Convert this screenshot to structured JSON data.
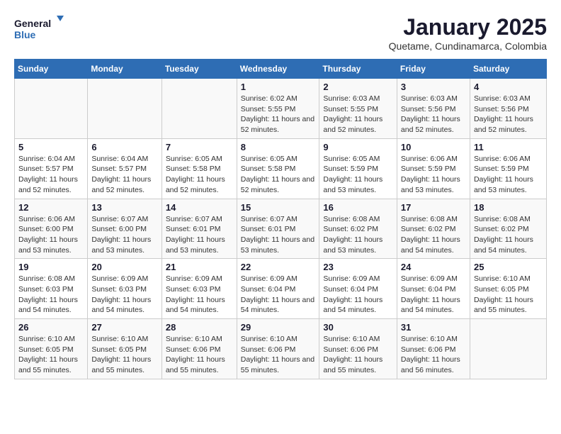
{
  "logo": {
    "text_general": "General",
    "text_blue": "Blue"
  },
  "title": "January 2025",
  "subtitle": "Quetame, Cundinamarca, Colombia",
  "headers": [
    "Sunday",
    "Monday",
    "Tuesday",
    "Wednesday",
    "Thursday",
    "Friday",
    "Saturday"
  ],
  "weeks": [
    [
      {
        "day": "",
        "sunrise": "",
        "sunset": "",
        "daylight": ""
      },
      {
        "day": "",
        "sunrise": "",
        "sunset": "",
        "daylight": ""
      },
      {
        "day": "",
        "sunrise": "",
        "sunset": "",
        "daylight": ""
      },
      {
        "day": "1",
        "sunrise": "Sunrise: 6:02 AM",
        "sunset": "Sunset: 5:55 PM",
        "daylight": "Daylight: 11 hours and 52 minutes."
      },
      {
        "day": "2",
        "sunrise": "Sunrise: 6:03 AM",
        "sunset": "Sunset: 5:55 PM",
        "daylight": "Daylight: 11 hours and 52 minutes."
      },
      {
        "day": "3",
        "sunrise": "Sunrise: 6:03 AM",
        "sunset": "Sunset: 5:56 PM",
        "daylight": "Daylight: 11 hours and 52 minutes."
      },
      {
        "day": "4",
        "sunrise": "Sunrise: 6:03 AM",
        "sunset": "Sunset: 5:56 PM",
        "daylight": "Daylight: 11 hours and 52 minutes."
      }
    ],
    [
      {
        "day": "5",
        "sunrise": "Sunrise: 6:04 AM",
        "sunset": "Sunset: 5:57 PM",
        "daylight": "Daylight: 11 hours and 52 minutes."
      },
      {
        "day": "6",
        "sunrise": "Sunrise: 6:04 AM",
        "sunset": "Sunset: 5:57 PM",
        "daylight": "Daylight: 11 hours and 52 minutes."
      },
      {
        "day": "7",
        "sunrise": "Sunrise: 6:05 AM",
        "sunset": "Sunset: 5:58 PM",
        "daylight": "Daylight: 11 hours and 52 minutes."
      },
      {
        "day": "8",
        "sunrise": "Sunrise: 6:05 AM",
        "sunset": "Sunset: 5:58 PM",
        "daylight": "Daylight: 11 hours and 52 minutes."
      },
      {
        "day": "9",
        "sunrise": "Sunrise: 6:05 AM",
        "sunset": "Sunset: 5:59 PM",
        "daylight": "Daylight: 11 hours and 53 minutes."
      },
      {
        "day": "10",
        "sunrise": "Sunrise: 6:06 AM",
        "sunset": "Sunset: 5:59 PM",
        "daylight": "Daylight: 11 hours and 53 minutes."
      },
      {
        "day": "11",
        "sunrise": "Sunrise: 6:06 AM",
        "sunset": "Sunset: 5:59 PM",
        "daylight": "Daylight: 11 hours and 53 minutes."
      }
    ],
    [
      {
        "day": "12",
        "sunrise": "Sunrise: 6:06 AM",
        "sunset": "Sunset: 6:00 PM",
        "daylight": "Daylight: 11 hours and 53 minutes."
      },
      {
        "day": "13",
        "sunrise": "Sunrise: 6:07 AM",
        "sunset": "Sunset: 6:00 PM",
        "daylight": "Daylight: 11 hours and 53 minutes."
      },
      {
        "day": "14",
        "sunrise": "Sunrise: 6:07 AM",
        "sunset": "Sunset: 6:01 PM",
        "daylight": "Daylight: 11 hours and 53 minutes."
      },
      {
        "day": "15",
        "sunrise": "Sunrise: 6:07 AM",
        "sunset": "Sunset: 6:01 PM",
        "daylight": "Daylight: 11 hours and 53 minutes."
      },
      {
        "day": "16",
        "sunrise": "Sunrise: 6:08 AM",
        "sunset": "Sunset: 6:02 PM",
        "daylight": "Daylight: 11 hours and 53 minutes."
      },
      {
        "day": "17",
        "sunrise": "Sunrise: 6:08 AM",
        "sunset": "Sunset: 6:02 PM",
        "daylight": "Daylight: 11 hours and 54 minutes."
      },
      {
        "day": "18",
        "sunrise": "Sunrise: 6:08 AM",
        "sunset": "Sunset: 6:02 PM",
        "daylight": "Daylight: 11 hours and 54 minutes."
      }
    ],
    [
      {
        "day": "19",
        "sunrise": "Sunrise: 6:08 AM",
        "sunset": "Sunset: 6:03 PM",
        "daylight": "Daylight: 11 hours and 54 minutes."
      },
      {
        "day": "20",
        "sunrise": "Sunrise: 6:09 AM",
        "sunset": "Sunset: 6:03 PM",
        "daylight": "Daylight: 11 hours and 54 minutes."
      },
      {
        "day": "21",
        "sunrise": "Sunrise: 6:09 AM",
        "sunset": "Sunset: 6:03 PM",
        "daylight": "Daylight: 11 hours and 54 minutes."
      },
      {
        "day": "22",
        "sunrise": "Sunrise: 6:09 AM",
        "sunset": "Sunset: 6:04 PM",
        "daylight": "Daylight: 11 hours and 54 minutes."
      },
      {
        "day": "23",
        "sunrise": "Sunrise: 6:09 AM",
        "sunset": "Sunset: 6:04 PM",
        "daylight": "Daylight: 11 hours and 54 minutes."
      },
      {
        "day": "24",
        "sunrise": "Sunrise: 6:09 AM",
        "sunset": "Sunset: 6:04 PM",
        "daylight": "Daylight: 11 hours and 54 minutes."
      },
      {
        "day": "25",
        "sunrise": "Sunrise: 6:10 AM",
        "sunset": "Sunset: 6:05 PM",
        "daylight": "Daylight: 11 hours and 55 minutes."
      }
    ],
    [
      {
        "day": "26",
        "sunrise": "Sunrise: 6:10 AM",
        "sunset": "Sunset: 6:05 PM",
        "daylight": "Daylight: 11 hours and 55 minutes."
      },
      {
        "day": "27",
        "sunrise": "Sunrise: 6:10 AM",
        "sunset": "Sunset: 6:05 PM",
        "daylight": "Daylight: 11 hours and 55 minutes."
      },
      {
        "day": "28",
        "sunrise": "Sunrise: 6:10 AM",
        "sunset": "Sunset: 6:06 PM",
        "daylight": "Daylight: 11 hours and 55 minutes."
      },
      {
        "day": "29",
        "sunrise": "Sunrise: 6:10 AM",
        "sunset": "Sunset: 6:06 PM",
        "daylight": "Daylight: 11 hours and 55 minutes."
      },
      {
        "day": "30",
        "sunrise": "Sunrise: 6:10 AM",
        "sunset": "Sunset: 6:06 PM",
        "daylight": "Daylight: 11 hours and 55 minutes."
      },
      {
        "day": "31",
        "sunrise": "Sunrise: 6:10 AM",
        "sunset": "Sunset: 6:06 PM",
        "daylight": "Daylight: 11 hours and 56 minutes."
      },
      {
        "day": "",
        "sunrise": "",
        "sunset": "",
        "daylight": ""
      }
    ]
  ]
}
